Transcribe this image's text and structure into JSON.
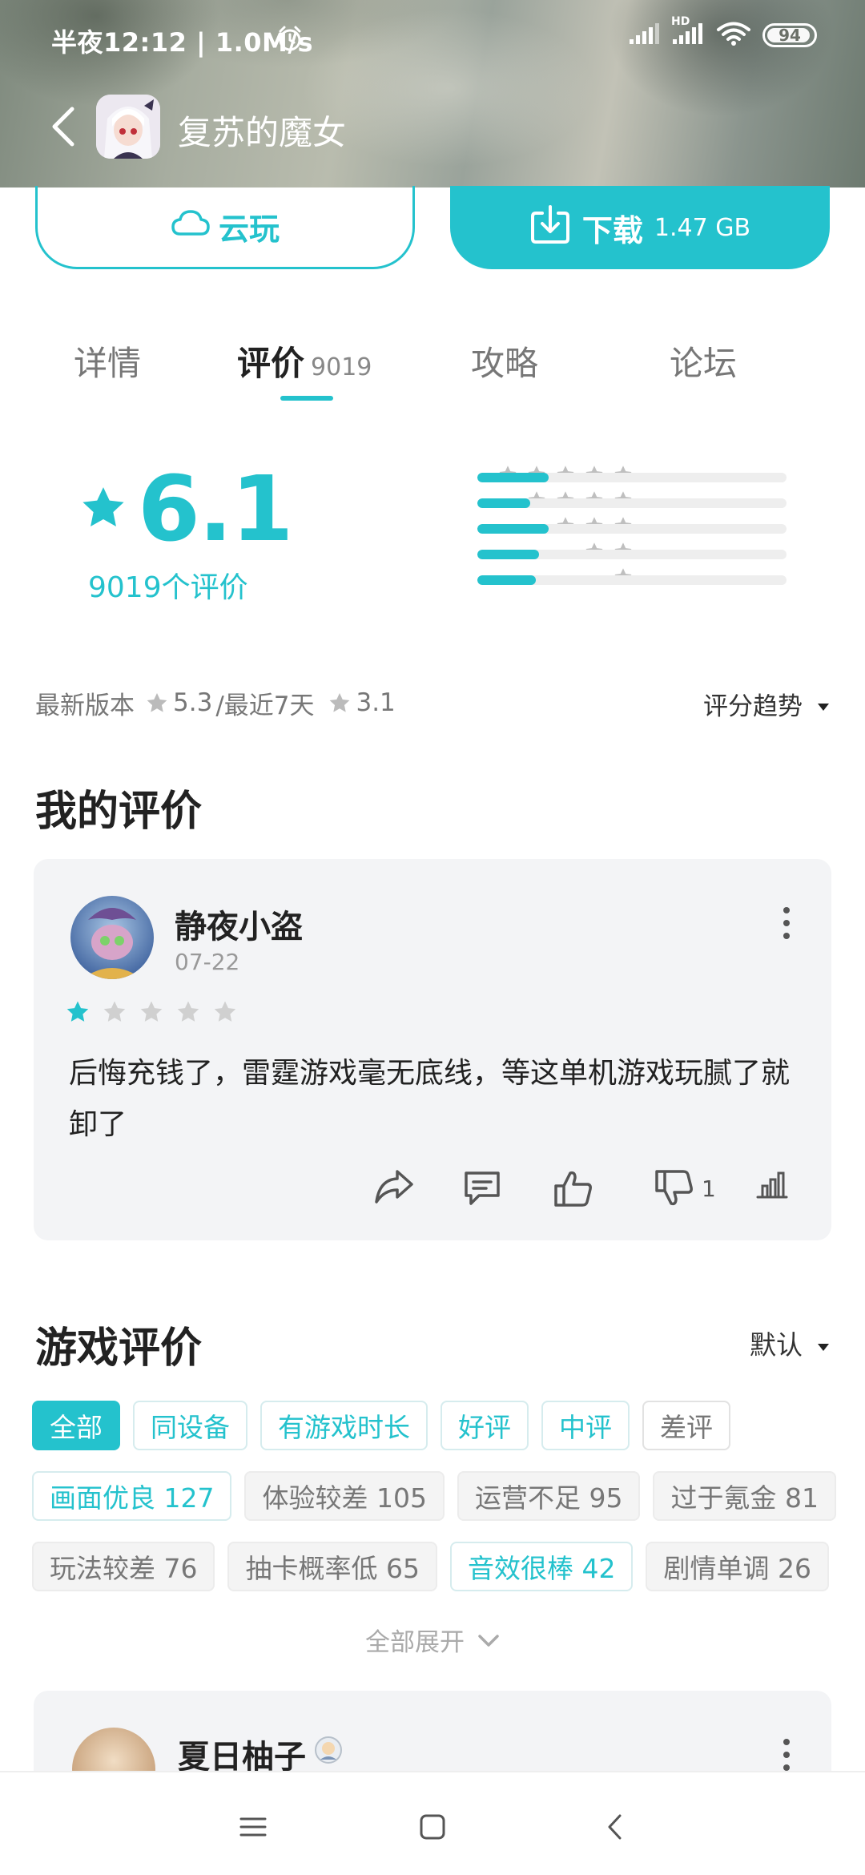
{
  "status_bar": {
    "time": "半夜12:12 | 1.0M/s",
    "network_label": "HD",
    "battery": "94",
    "icons": [
      "alarm-icon",
      "signal-icon",
      "hd-signal-icon",
      "wifi-icon",
      "battery-icon"
    ]
  },
  "nav": {
    "title": "复苏的魔女",
    "icons": [
      "back-icon",
      "app-icon"
    ]
  },
  "actions": {
    "cloud_play_label": "云玩",
    "download_label": "下载",
    "download_size": "1.47 GB"
  },
  "tabs": [
    {
      "label": "详情",
      "count": "",
      "active": false
    },
    {
      "label": "评价",
      "count": "9019",
      "active": true
    },
    {
      "label": "攻略",
      "count": "",
      "active": false
    },
    {
      "label": "论坛",
      "count": "",
      "active": false
    }
  ],
  "rating": {
    "score": "6.1",
    "count_label": "9019个评价",
    "distribution": [
      {
        "stars": 5,
        "fraction": 0.23
      },
      {
        "stars": 4,
        "fraction": 0.17
      },
      {
        "stars": 3,
        "fraction": 0.23
      },
      {
        "stars": 2,
        "fraction": 0.2
      },
      {
        "stars": 1,
        "fraction": 0.19
      }
    ],
    "accent_color": "#24c2cd"
  },
  "version_info": {
    "latest_label": "最新版本",
    "latest_score": "5.3",
    "recent_label": "/最近7天",
    "recent_score": "3.1",
    "trend_label": "评分趋势"
  },
  "my_review": {
    "section_title": "我的评价",
    "username": "静夜小盗",
    "date": "07-22",
    "stars": 1,
    "text": "后悔充钱了，雷霆游戏毫无底线，等这单机游戏玩腻了就卸了",
    "dislike_count": "1"
  },
  "game_reviews": {
    "section_title": "游戏评价",
    "sort_label": "默认",
    "filters_row1": [
      {
        "label": "全部",
        "style": "selected"
      },
      {
        "label": "同设备",
        "style": "accent"
      },
      {
        "label": "有游戏时长",
        "style": "accent"
      },
      {
        "label": "好评",
        "style": "accent"
      },
      {
        "label": "中评",
        "style": "accent"
      },
      {
        "label": "差评",
        "style": "plain"
      }
    ],
    "filters_row2": [
      {
        "label": "画面优良 127",
        "style": "accent"
      },
      {
        "label": "体验较差 105",
        "style": "gray"
      },
      {
        "label": "运营不足 95",
        "style": "gray"
      },
      {
        "label": "过于氪金 81",
        "style": "gray"
      }
    ],
    "filters_row3": [
      {
        "label": "玩法较差 76",
        "style": "gray"
      },
      {
        "label": "抽卡概率低 65",
        "style": "gray"
      },
      {
        "label": "音效很棒 42",
        "style": "accent"
      },
      {
        "label": "剧情单调 26",
        "style": "gray"
      }
    ],
    "expand_label": "全部展开",
    "next_review_username": "夏日柚子"
  }
}
